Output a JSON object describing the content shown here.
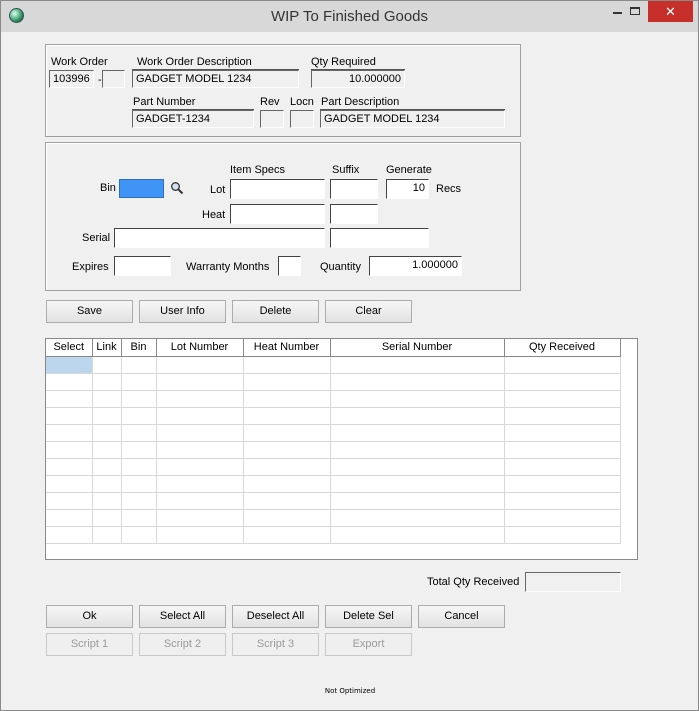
{
  "window": {
    "title": "WIP To Finished Goods",
    "min_glyph": "",
    "close_glyph": "✕"
  },
  "header": {
    "work_order_label": "Work Order",
    "work_order_value": "103996",
    "work_order_sep": "-",
    "work_order_suffix": "",
    "wo_desc_label": "Work Order Description",
    "wo_desc_value": "GADGET MODEL 1234",
    "qty_required_label": "Qty Required",
    "qty_required_value": "10.000000",
    "part_number_label": "Part Number",
    "part_number_value": "GADGET-1234",
    "rev_label": "Rev",
    "rev_value": "",
    "locn_label": "Locn",
    "locn_value": "",
    "part_desc_label": "Part Description",
    "part_desc_value": "GADGET MODEL 1234"
  },
  "entry": {
    "bin_label": "Bin",
    "bin_value": "",
    "item_specs_label": "Item Specs",
    "suffix_label": "Suffix",
    "generate_label": "Generate",
    "lot_label": "Lot",
    "lot_value": "",
    "lot_suffix_value": "",
    "generate_value": "10",
    "recs_label": "Recs",
    "heat_label": "Heat",
    "heat_value": "",
    "heat_suffix_value": "",
    "serial_label": "Serial",
    "serial_value": "",
    "serial_suffix_value": "",
    "expires_label": "Expires",
    "expires_value": "",
    "warranty_label": "Warranty Months",
    "warranty_value": "",
    "quantity_label": "Quantity",
    "quantity_value": "1.000000"
  },
  "actions": {
    "save": "Save",
    "user_info": "User Info",
    "delete": "Delete",
    "clear": "Clear"
  },
  "grid": {
    "columns": [
      "Select",
      "Link",
      "Bin",
      "Lot Number",
      "Heat Number",
      "Serial Number",
      "Qty Received"
    ],
    "row_count": 11
  },
  "totals": {
    "total_qty_label": "Total Qty Received",
    "total_qty_value": ""
  },
  "footer_buttons": {
    "ok": "Ok",
    "select_all": "Select All",
    "deselect_all": "Deselect All",
    "delete_sel": "Delete Sel",
    "cancel": "Cancel",
    "script1": "Script 1",
    "script2": "Script 2",
    "script3": "Script 3",
    "export": "Export"
  },
  "status_text": "Not Optimized"
}
